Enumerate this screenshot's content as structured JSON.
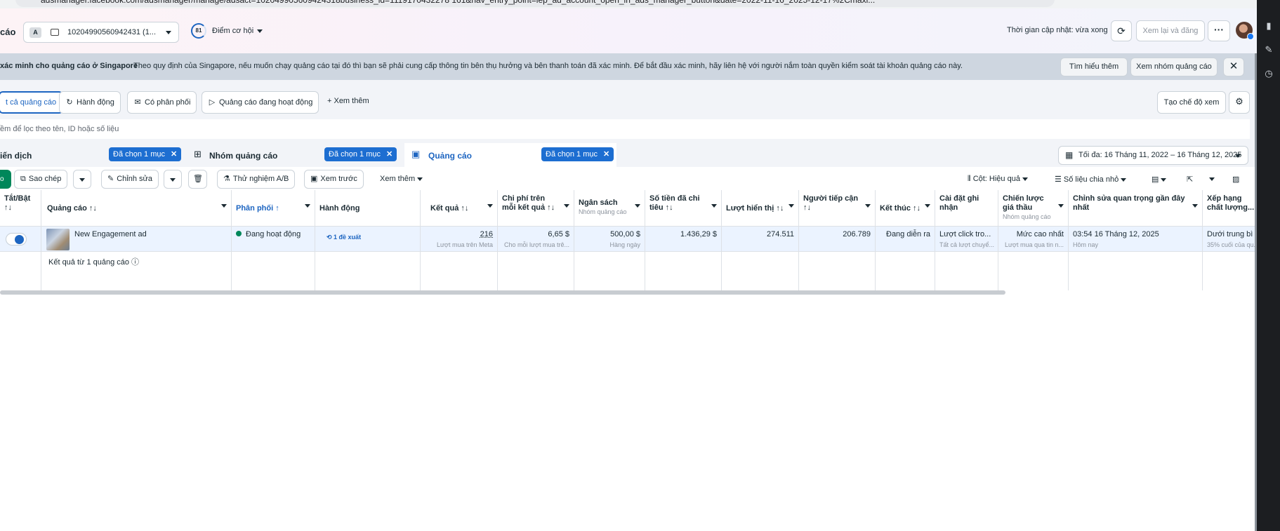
{
  "browser": {
    "url": "adsmanager.facebook.com/adsmanager/manage/adsact=102049905609424318business_id=1119170432278 161&nav_entry_point=lep_ad_account_open_in_ads_manager_button&date=2022-11-16_2025-12-17%2Cmaxi..."
  },
  "header": {
    "page_label": "cáo",
    "account_badge": "A",
    "account_id": "10204990560942431 (1...",
    "score": "81",
    "score_label": "Điểm cơ hội",
    "updated_text": "Thời gian cập nhật: vừa xong",
    "review_publish": "Xem lại và đăng",
    "more": "···"
  },
  "banner": {
    "title": "xác minh cho quảng cáo ở Singapore",
    "text": "Theo quy định của Singapore, nếu muốn chạy quảng cáo tại đó thì bạn sẽ phải cung cấp thông tin bên thụ hưởng và bên thanh toán đã xác minh. Để bắt đầu xác minh, hãy liên hệ với người nắm toàn quyền kiểm soát tài khoản quảng cáo này.",
    "learn_more": "Tìm hiểu thêm",
    "view_ad_groups": "Xem nhóm quảng cáo",
    "close": "✕"
  },
  "filters": {
    "chips": [
      {
        "label": "t cả quảng cáo",
        "icon": ""
      },
      {
        "label": "Hành động",
        "icon": "↻"
      },
      {
        "label": "Có phân phối",
        "icon": "✉"
      },
      {
        "label": "Quảng cáo đang hoạt động",
        "icon": "▷"
      }
    ],
    "see_more": "+  Xem thêm",
    "create_view": "Tạo chế độ xem",
    "search_placeholder": "ềm để lọc theo tên, ID hoặc số liệu"
  },
  "level_tabs": [
    {
      "label": "iến dịch",
      "chip": "Đã chọn 1 mục"
    },
    {
      "label": "Nhóm quảng cáo",
      "chip": "Đã chọn 1 mục"
    },
    {
      "label": "Quảng cáo",
      "chip": "Đã chọn 1 mục"
    }
  ],
  "date_range": "Tối đa: 16 Tháng 11, 2022 – 16 Tháng 12, 2025",
  "toolbar": {
    "create": "o",
    "duplicate": "Sao chép",
    "edit": "Chỉnh sửa",
    "delete_icon": "🗑",
    "ab_test": "Thử nghiệm A/B",
    "preview": "Xem trước",
    "see_more": "Xem thêm",
    "columns": "Cột: Hiệu quả",
    "breakdown": "Số liệu chia nhỏ"
  },
  "table": {
    "columns": [
      {
        "label": "Tắt/Bật",
        "sub": "",
        "icon": "↑↓"
      },
      {
        "label": "Quảng cáo ↑↓",
        "sub": ""
      },
      {
        "label": "Phân phối ↑",
        "sub": ""
      },
      {
        "label": "Hành động",
        "sub": ""
      },
      {
        "label": "Kết quả ↑↓",
        "sub": ""
      },
      {
        "label": "Chi phí trên mỗi kết quả ↑↓",
        "sub": ""
      },
      {
        "label": "Ngân sách",
        "sub": "Nhóm quảng cáo"
      },
      {
        "label": "Số tiền đã chi tiêu ↑↓",
        "sub": ""
      },
      {
        "label": "Lượt hiển thị ↑↓",
        "sub": ""
      },
      {
        "label": "Người tiếp cận ↑↓",
        "sub": ""
      },
      {
        "label": "Kết thúc ↑↓",
        "sub": ""
      },
      {
        "label": "Cài đặt ghi nhận",
        "sub": ""
      },
      {
        "label": "Chiến lược giá thầu",
        "sub": "Nhóm quảng cáo"
      },
      {
        "label": "Chỉnh sửa quan trọng gần đây nhất",
        "sub": ""
      },
      {
        "label": "Xếp hạng chất lượng...",
        "sub": ""
      }
    ],
    "row": {
      "ad_name": "New Engagement ad",
      "delivery": "Đang hoạt động",
      "action": "1 đề xuất",
      "results": "216",
      "results_sub": "Lượt mua trên Meta",
      "cost": "6,65 $",
      "cost_sub": "Cho mỗi lượt mua trê...",
      "budget": "500,00 $",
      "budget_sub": "Hàng ngày",
      "spent": "1.436,29 $",
      "impressions": "274.511",
      "reach": "206.789",
      "ends": "Đang diễn ra",
      "attribution": "Lượt click tro...",
      "attribution_sub": "Tất cả lượt chuyể...",
      "bid": "Mức cao nhất",
      "bid_sub": "Lượt mua qua tin n...",
      "last_edit": "03:54 16 Tháng 12, 2025",
      "last_edit_sub": "Hôm nay",
      "quality": "Dưới trung bì",
      "quality_sub": "35% cuối của qu..."
    },
    "footer": "Kết quả từ 1 quảng cáo ⓘ"
  }
}
